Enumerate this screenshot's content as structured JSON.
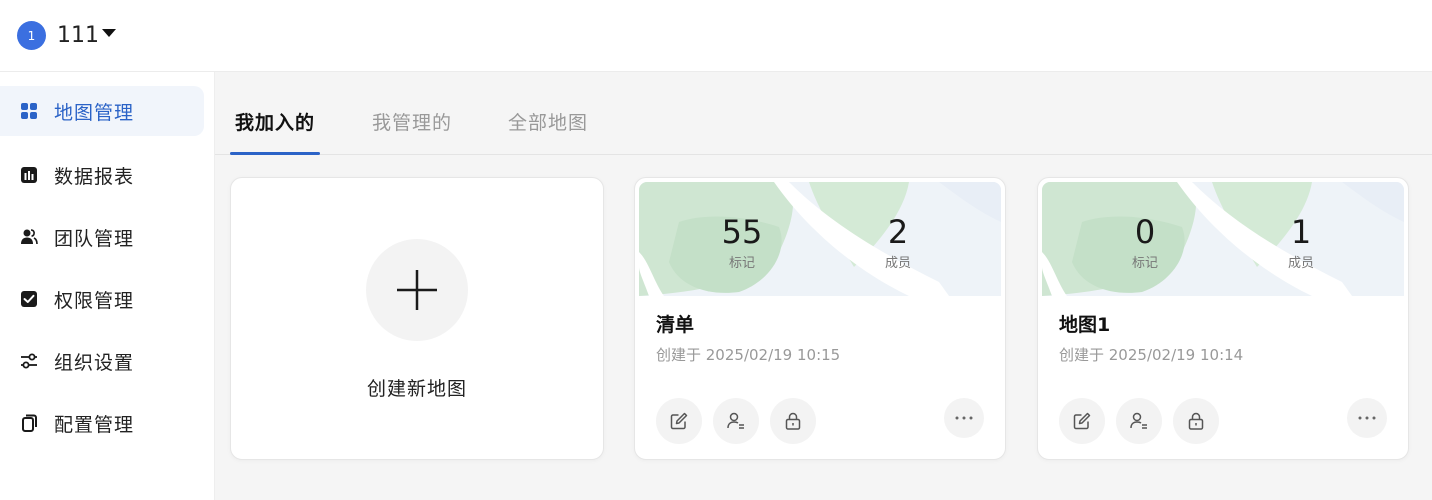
{
  "header": {
    "avatar_text": "1",
    "user_name": "111"
  },
  "sidebar": {
    "items": [
      {
        "label": "地图管理",
        "icon": "grid-icon",
        "active": true
      },
      {
        "label": "数据报表",
        "icon": "bar-chart-icon",
        "active": false
      },
      {
        "label": "团队管理",
        "icon": "team-icon",
        "active": false
      },
      {
        "label": "权限管理",
        "icon": "checkbox-icon",
        "active": false
      },
      {
        "label": "组织设置",
        "icon": "sliders-icon",
        "active": false
      },
      {
        "label": "配置管理",
        "icon": "copy-icon",
        "active": false
      }
    ]
  },
  "tabs": [
    {
      "label": "我加入的",
      "active": true
    },
    {
      "label": "我管理的",
      "active": false
    },
    {
      "label": "全部地图",
      "active": false
    }
  ],
  "create_card": {
    "label": "创建新地图"
  },
  "maps": [
    {
      "title": "清单",
      "date": "创建于 2025/02/19 10:15",
      "markers": "55",
      "markers_label": "标记",
      "members": "2",
      "members_label": "成员"
    },
    {
      "title": "地图1",
      "date": "创建于 2025/02/19 10:14",
      "markers": "0",
      "markers_label": "标记",
      "members": "1",
      "members_label": "成员"
    }
  ],
  "colors": {
    "accent": "#2b63c7",
    "avatar": "#3b6fe0",
    "map_green": "#cfe7d3",
    "map_bg": "#eef2f7"
  }
}
